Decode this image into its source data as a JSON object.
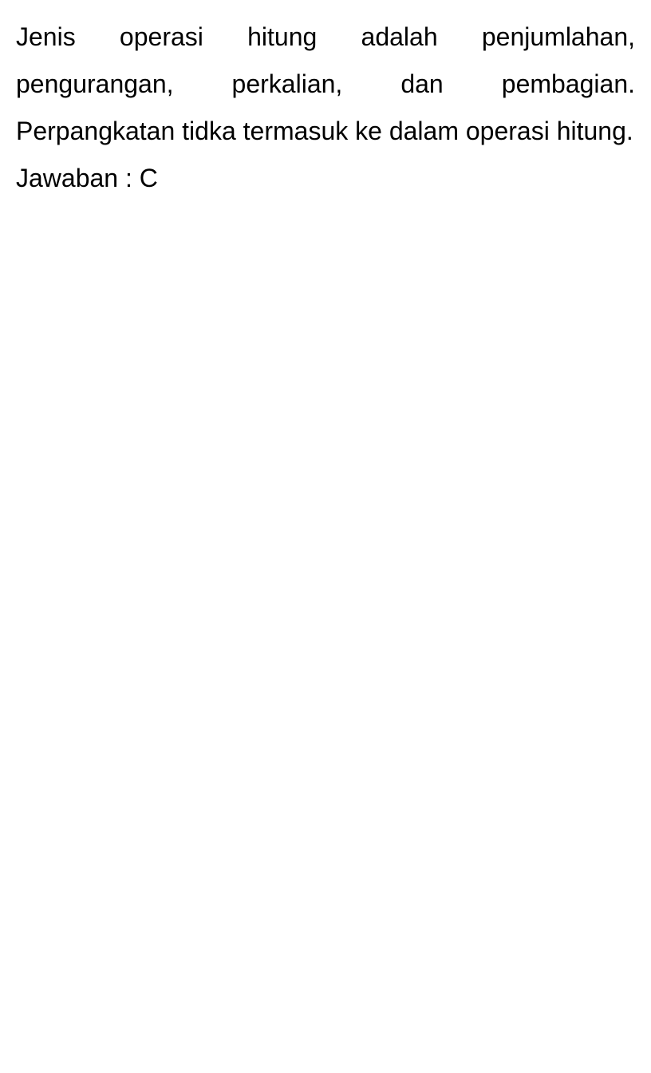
{
  "document": {
    "explanation": "Jenis operasi hitung adalah penjumlahan, pengurangan, perkalian, dan pembagian. Perpangkatan tidka termasuk ke dalam operasi hitung.",
    "answer": "Jawaban : C"
  }
}
